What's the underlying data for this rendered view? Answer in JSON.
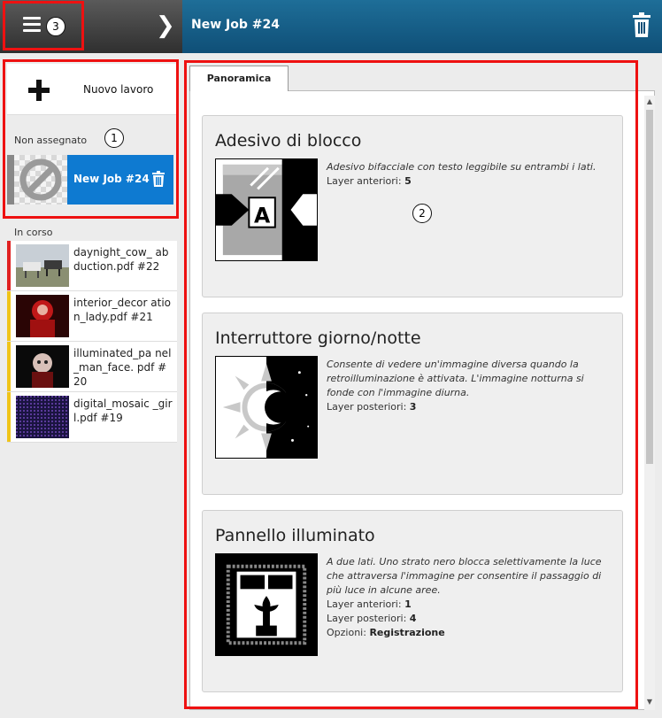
{
  "header": {
    "job_title": "New Job #24",
    "menu_icon": "hamburger-menu-icon",
    "chevron_icon": "chevron-right-icon",
    "trash_icon": "trash-icon"
  },
  "callouts": [
    "1",
    "2",
    "3"
  ],
  "sidebar": {
    "new_job_label": "Nuovo lavoro",
    "unassigned_label": "Non assegnato",
    "selected_job": {
      "label": "New Job #24"
    },
    "in_progress_label": "In corso",
    "jobs": [
      {
        "name": "daynight_cow_ abduction.pdf #22",
        "status_color": "#e02020"
      },
      {
        "name": "interior_decor ation_lady.pdf #21",
        "status_color": "#f0c419"
      },
      {
        "name": "illuminated_pa nel_man_face. pdf #20",
        "status_color": "#f0c419"
      },
      {
        "name": "digital_mosaic _girl.pdf #19",
        "status_color": "#f0c419"
      }
    ]
  },
  "main": {
    "tab_label": "Panoramica",
    "cards": [
      {
        "title": "Adesivo di blocco",
        "description": "Adesivo bifacciale con testo leggibile su entrambi i lati.",
        "props": [
          {
            "label": "Layer anteriori:",
            "value": "5"
          }
        ]
      },
      {
        "title": "Interruttore giorno/notte",
        "description": "Consente di vedere un'immagine diversa quando la retroilluminazione è attivata. L'immagine notturna si fonde con l'immagine diurna.",
        "props": [
          {
            "label": "Layer posteriori:",
            "value": "3"
          }
        ]
      },
      {
        "title": "Pannello illuminato",
        "description": "A due lati. Uno strato nero blocca selettivamente la luce che attraversa l'immagine per consentire il passaggio di più luce in alcune aree.",
        "props": [
          {
            "label": "Layer anteriori:",
            "value": "1"
          },
          {
            "label": "Layer posteriori:",
            "value": "4"
          },
          {
            "label": "Opzioni:",
            "value": "Registrazione"
          }
        ]
      }
    ]
  },
  "colors": {
    "header_blue": "#0f4f77",
    "selected_blue": "#0e7ad1",
    "highlight_red": "#e11111"
  }
}
